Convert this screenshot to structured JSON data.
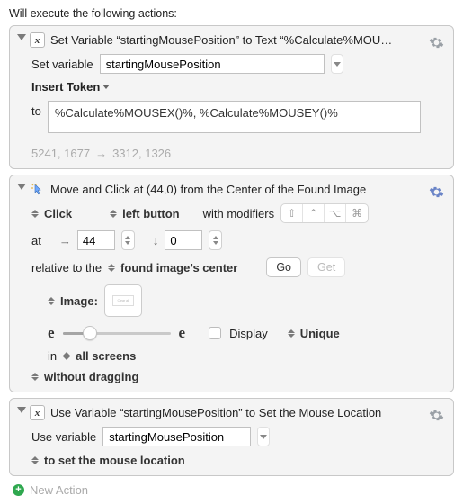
{
  "heading": "Will execute the following actions:",
  "actions": [
    {
      "title": "Set Variable “startingMousePosition” to Text “%Calculate%MOU…",
      "icon_glyph": "x",
      "set_variable_label": "Set variable",
      "variable_name": "startingMousePosition",
      "insert_token_label": "Insert Token",
      "to_label": "to",
      "to_value": "%Calculate%MOUSEX()%, %Calculate%MOUSEY()%",
      "footer_from": "5241, 1677",
      "footer_to": "3312, 1326"
    },
    {
      "title": "Move and Click at (44,0) from the Center of the Found Image",
      "click_label": "Click",
      "button_label": "left button",
      "with_modifiers_label": "with modifiers",
      "modifiers": [
        "⇧",
        "⌃",
        "⌥",
        "⌘"
      ],
      "at_label": "at",
      "x_arrow": "→",
      "x_value": "44",
      "y_arrow": "↓",
      "y_value": "0",
      "relative_label": "relative to the",
      "relative_value": "found image’s center",
      "go_label": "Go",
      "get_label": "Get",
      "image_label": "Image:",
      "fuzz_glyph": "e",
      "display_label": "Display",
      "unique_label": "Unique",
      "in_label": "in",
      "in_value": "all screens",
      "drag_value": "without dragging"
    },
    {
      "title": "Use Variable “startingMousePosition” to Set the Mouse Location",
      "icon_glyph": "x",
      "use_variable_label": "Use variable",
      "variable_name": "startingMousePosition",
      "set_mouse_label": "to set the mouse location"
    }
  ],
  "new_action_label": "New Action"
}
